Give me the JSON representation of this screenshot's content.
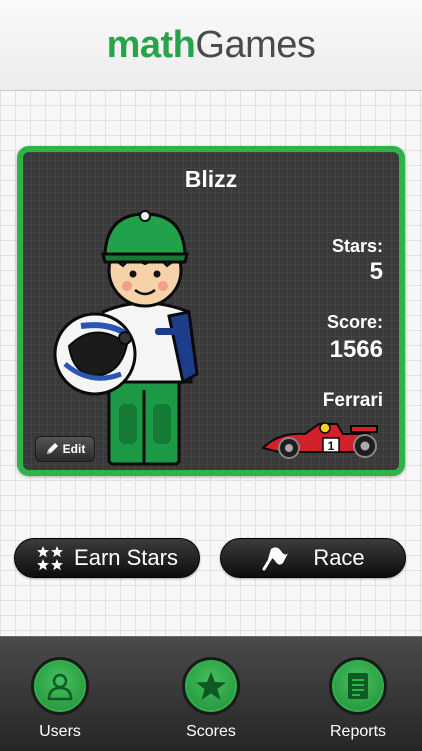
{
  "header": {
    "title_part1": "math",
    "title_part2": "Games"
  },
  "player": {
    "name": "Blizz",
    "stars_label": "Stars:",
    "stars_value": "5",
    "score_label": "Score:",
    "score_value": "1566",
    "car_name": "Ferrari",
    "car_number": "1",
    "edit_label": "Edit"
  },
  "actions": {
    "earn_label": "Earn Stars",
    "race_label": "Race"
  },
  "tabs": [
    {
      "label": "Users",
      "icon": "user-icon"
    },
    {
      "label": "Scores",
      "icon": "star-icon"
    },
    {
      "label": "Reports",
      "icon": "report-icon"
    }
  ],
  "colors": {
    "accent_green": "#2eb24a",
    "card_bg": "#3a3a3a",
    "tabbar_bg": "#333333"
  }
}
